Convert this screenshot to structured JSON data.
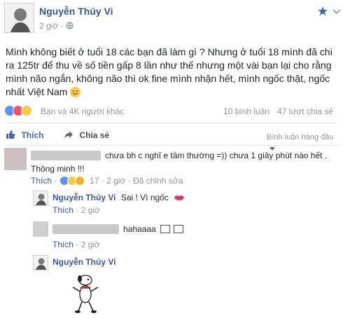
{
  "post": {
    "author": "Nguyễn Thúy Vi",
    "time": "2 giờ",
    "globe_icon": "globe-icon",
    "body": "Mình không biết ở tuổi 18 các bạn đã làm gì ? Nhưng ở tuổi 18 mình đã chi ra 125tr để thu về số tiền gấp 8 lần như thế nhưng một vài bạn lại cho rằng mình não ngắn, không não thì ok fine mình nhận hết, mình ngốc thật, ngốc nhất Việt Nam",
    "reactions_text": "Bạn và 4K người khác",
    "comments_count": "10 bình luận",
    "shares_count": "47 lượt chia sẻ",
    "like_label": "Thích",
    "share_label": "Chia sẻ",
    "sort_label": "Bình luận hàng đầu"
  },
  "comments": [
    {
      "text_line1": "chưa bh c nghĩ e tầm thường =)) chưa 1 giây phút nào hết .",
      "text_line2": "Thông minh !!!",
      "like": "Thích",
      "reaction_count": "17",
      "time": "2 giờ",
      "edited": "Đã chỉnh sửa"
    }
  ],
  "replies": [
    {
      "author": "Nguyễn Thúy Vi",
      "text": "Sai ! Vì ngốc",
      "like": "Thích",
      "time": "2 giờ"
    },
    {
      "text": "hahaaaa",
      "like": "Thích",
      "time": "2 giờ"
    },
    {
      "author": "Nguyễn Thúy Vi"
    }
  ],
  "colors": {
    "link": "#365899",
    "like_blue": "#4267b2",
    "meta_gray": "#90949c",
    "star": "#4267b2"
  }
}
